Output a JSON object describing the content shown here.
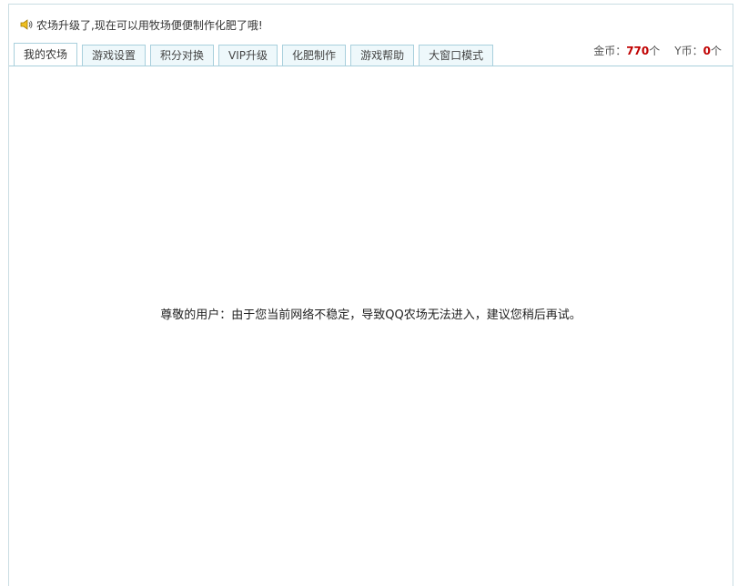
{
  "notice": {
    "icon": "speaker-icon",
    "text": "农场升级了,现在可以用牧场便便制作化肥了哦!"
  },
  "tabs": [
    {
      "label": "我的农场",
      "active": true
    },
    {
      "label": "游戏设置",
      "active": false
    },
    {
      "label": "积分对换",
      "active": false
    },
    {
      "label": "VIP升级",
      "active": false
    },
    {
      "label": "化肥制作",
      "active": false
    },
    {
      "label": "游戏帮助",
      "active": false
    },
    {
      "label": "大窗口模式",
      "active": false
    }
  ],
  "currency": {
    "gold_label": "金币：",
    "gold_value": "770",
    "gold_unit": "个",
    "y_label": "Y币：",
    "y_value": "0",
    "y_unit": "个"
  },
  "main": {
    "message": "尊敬的用户：由于您当前网络不稳定，导致QQ农场无法进入，建议您稍后再试。"
  },
  "colors": {
    "tab_border": "#a8cfdc",
    "tab_bg": "#eef8fb",
    "value_red": "#c00000"
  }
}
